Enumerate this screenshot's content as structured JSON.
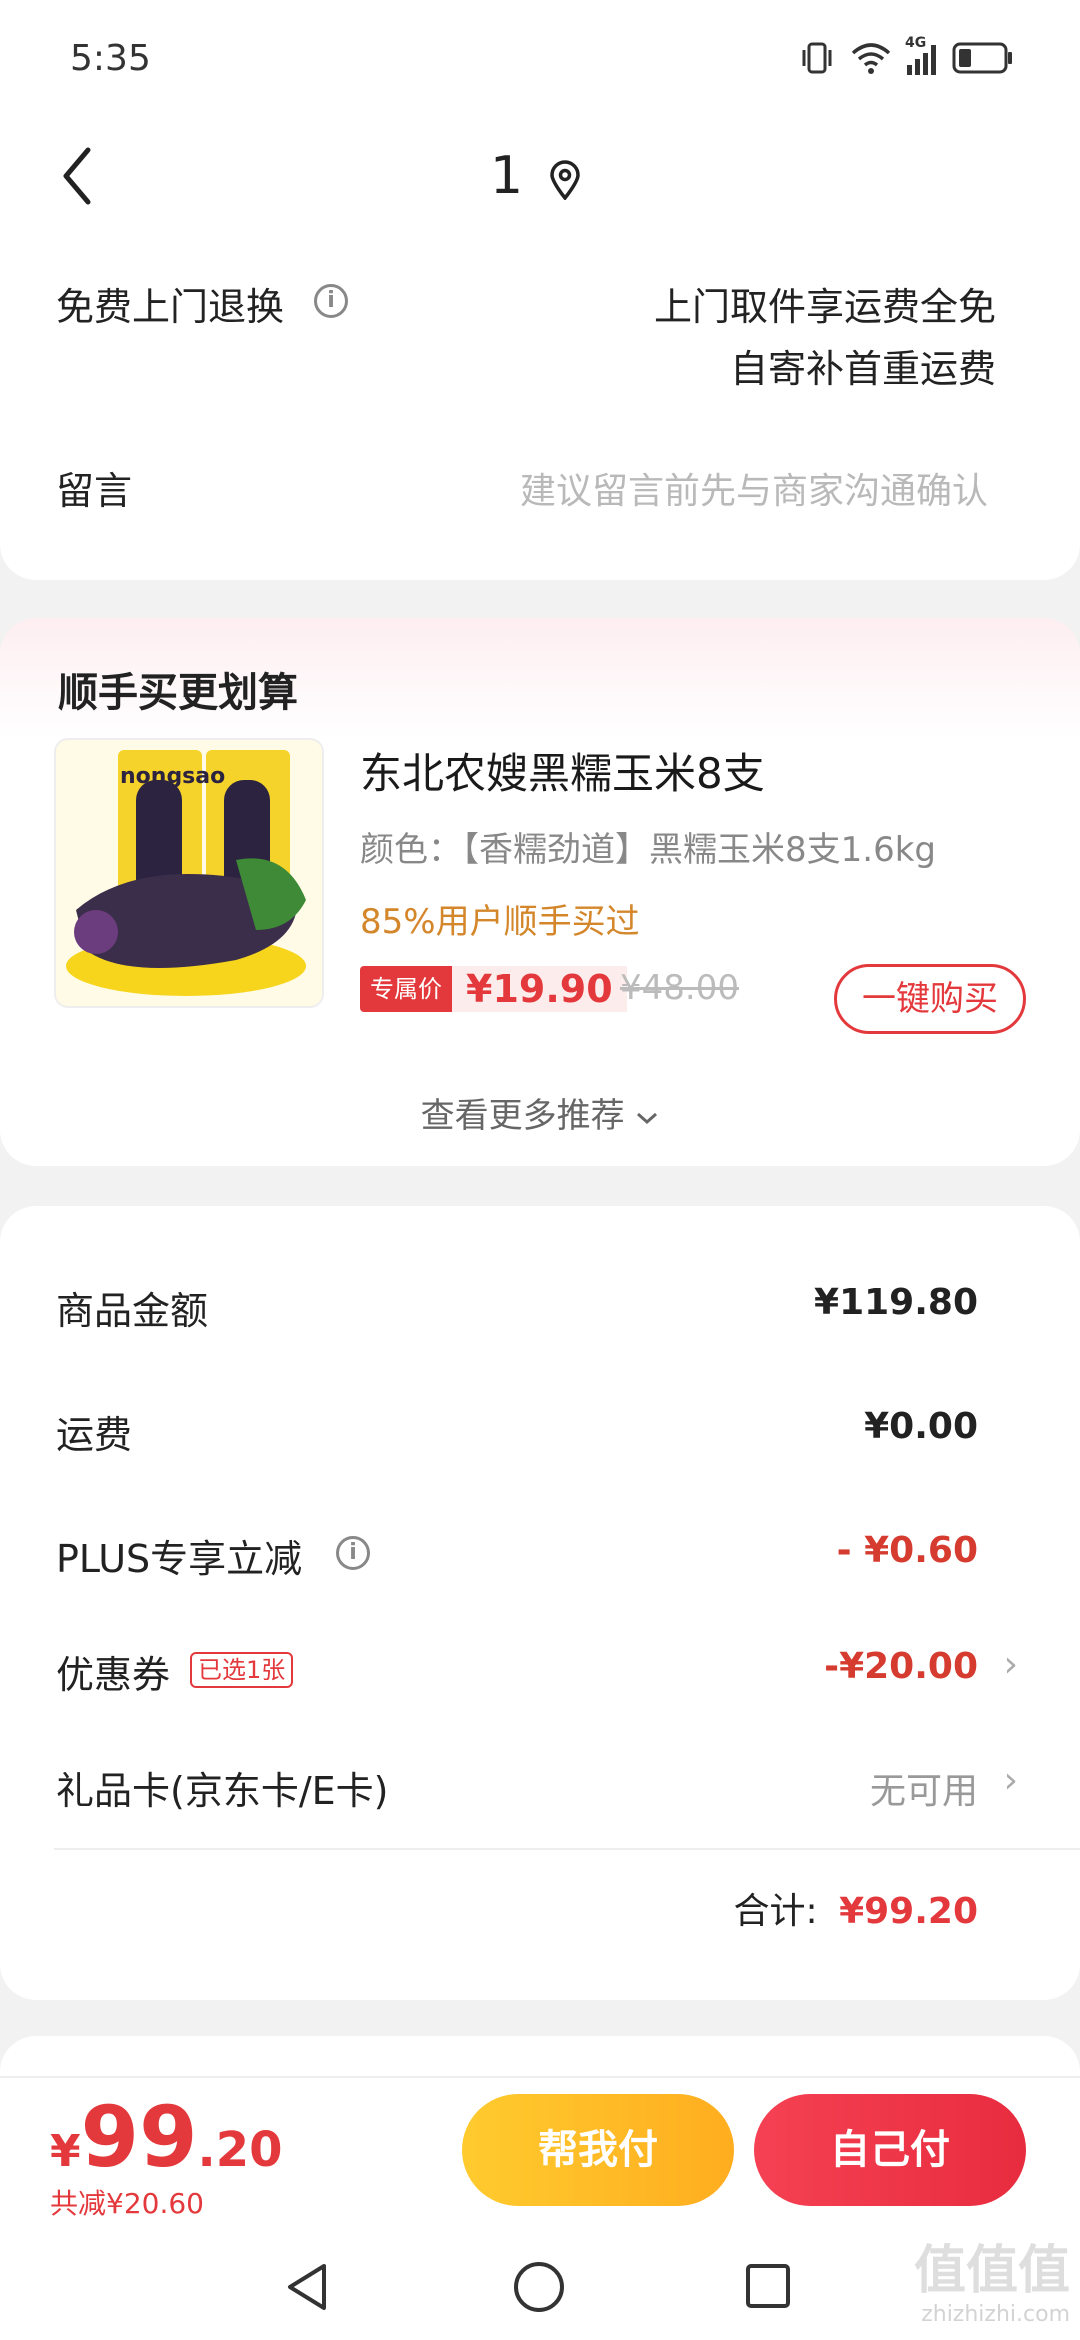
{
  "status_bar": {
    "time": "5:35",
    "network": "4G"
  },
  "header": {
    "title": "1"
  },
  "return_row": {
    "label": "免费上门退换",
    "line1": "上门取件享运费全免",
    "line2": "自寄补首重运费"
  },
  "message_row": {
    "label": "留言",
    "placeholder": "建议留言前先与商家沟通确认"
  },
  "recommend": {
    "title": "顺手买更划算",
    "product": {
      "name": "东北农嫂黑糯玉米8支",
      "spec": "颜色：【香糯劲道】黑糯玉米8支1.6kg",
      "bought": "85%用户顺手买过",
      "price_badge": "专属价",
      "price": "¥19.90",
      "original_price": "¥48.00",
      "buy_label": "一键购买",
      "brand_text": "nongsao"
    },
    "more_label": "查看更多推荐"
  },
  "price_detail": {
    "goods_label": "商品金额",
    "goods_value": "¥119.80",
    "shipping_label": "运费",
    "shipping_value": "¥0.00",
    "plus_label": "PLUS专享立减",
    "plus_value": "- ¥0.60",
    "coupon_label": "优惠券",
    "coupon_badge": "已选1张",
    "coupon_value": "-¥20.00",
    "giftcard_label": "礼品卡(京东卡/E卡)",
    "giftcard_value": "无可用",
    "total_label": "合计:",
    "total_value": "¥99.20"
  },
  "bottom_bar": {
    "currency": "¥",
    "price_int": "99",
    "price_dec": ".20",
    "saved": "共减¥20.60",
    "help_pay": "帮我付",
    "self_pay": "自己付"
  },
  "watermark": {
    "main": "值值值",
    "sub": "zhizhizhi.com"
  },
  "colors": {
    "accent": "#e4393c",
    "yellow": "#ffc12a",
    "gray_text": "#888888"
  }
}
